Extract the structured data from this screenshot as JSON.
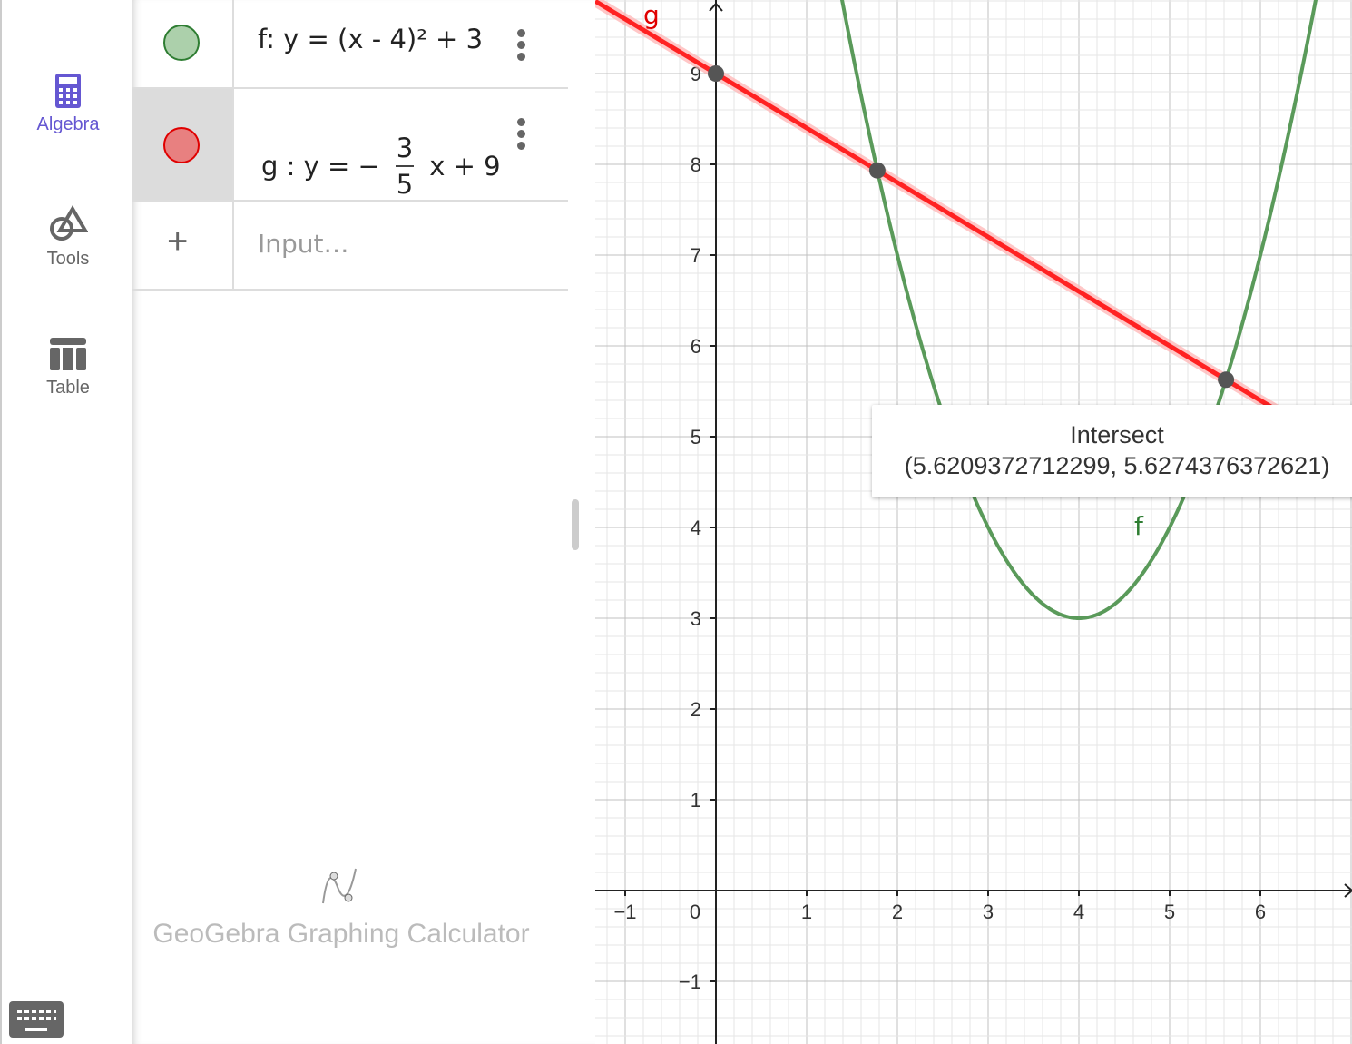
{
  "sidebar": {
    "items": [
      {
        "label": "Algebra",
        "icon": "calculator-icon",
        "active": true
      },
      {
        "label": "Tools",
        "icon": "shapes-icon"
      },
      {
        "label": "Table",
        "icon": "table-icon"
      }
    ],
    "accent": "#6557d2"
  },
  "algebra": {
    "rows": [
      {
        "name": "f",
        "text": "f: y = (x - 4)² + 3",
        "color": "#2e7d32",
        "fill": "#acd0ab"
      },
      {
        "name": "g",
        "prefix": "g : y = −",
        "num": "3",
        "den": "5",
        "suffix": "x + 9",
        "color": "#e00000",
        "fill": "#e88080"
      }
    ],
    "input_placeholder": "Input…",
    "brand": "GeoGebra Graphing Calculator"
  },
  "graph": {
    "xlim": [
      -1.33,
      7.01
    ],
    "ylim": [
      -1.69,
      9.81
    ],
    "x_ticks": [
      "−1",
      "0",
      "1",
      "2",
      "3",
      "4",
      "5",
      "6"
    ],
    "y_ticks": [
      "−1",
      "1",
      "2",
      "3",
      "4",
      "5",
      "6",
      "7",
      "8",
      "9"
    ],
    "functions": [
      {
        "label": "f",
        "expr": "(x-4)^2+3",
        "color": "#5a9a5a"
      },
      {
        "label": "g",
        "expr": "-0.6x+9",
        "color": "#ff2222"
      }
    ],
    "points": [
      [
        0,
        9
      ],
      [
        1.7790627288,
        7.9325623627
      ],
      [
        5.6209372712299,
        5.6274376372621
      ]
    ],
    "tooltip": {
      "title": "Intersect",
      "value": "(5.6209372712299, 5.6274376372621)"
    }
  }
}
